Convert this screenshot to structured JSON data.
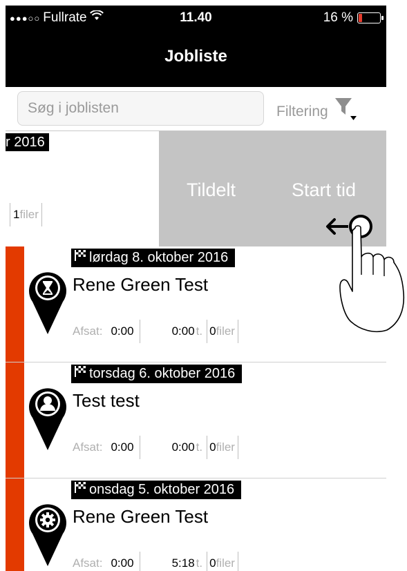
{
  "status_bar": {
    "signal": "●●●○○",
    "carrier": "Fullrate",
    "time": "11.40",
    "battery_percent": "16 %",
    "battery_level": 0.16
  },
  "nav": {
    "title": "Jobliste"
  },
  "search": {
    "placeholder": "Søg i joblisten",
    "value": ""
  },
  "filter": {
    "label": "Filtering",
    "icon": "funnel-icon"
  },
  "swiped_row": {
    "date_fragment": "r 2016",
    "files_count": "1",
    "files_label": " filer",
    "actions": {
      "assigned": "Tildelt",
      "start_time": "Start tid"
    }
  },
  "jobs": [
    {
      "date": "lørdag 8. oktober 2016",
      "title": "Rene Green Test",
      "icon": "hourglass-icon",
      "spent_label": "Afsat:",
      "spent": "0:00",
      "time": "0:00",
      "time_unit": " t.",
      "files_count": "0",
      "files_label": " filer"
    },
    {
      "date": "torsdag 6. oktober 2016",
      "title": "Test test",
      "icon": "person-icon",
      "spent_label": "Afsat:",
      "spent": "0:00",
      "time": "0:00",
      "time_unit": " t.",
      "files_count": "0",
      "files_label": " filer"
    },
    {
      "date": "onsdag 5. oktober 2016",
      "title": "Rene Green Test",
      "icon": "gear-icon",
      "spent_label": "Afsat:",
      "spent": "0:00",
      "time": "5:18",
      "time_unit": " t.",
      "files_count": "0",
      "files_label": " filer"
    }
  ],
  "colors": {
    "accent": "#e33a00",
    "action_bg": "#c4c4c4",
    "bar": "#000000"
  },
  "gesture": {
    "icon": "swipe-left-hand-icon"
  }
}
